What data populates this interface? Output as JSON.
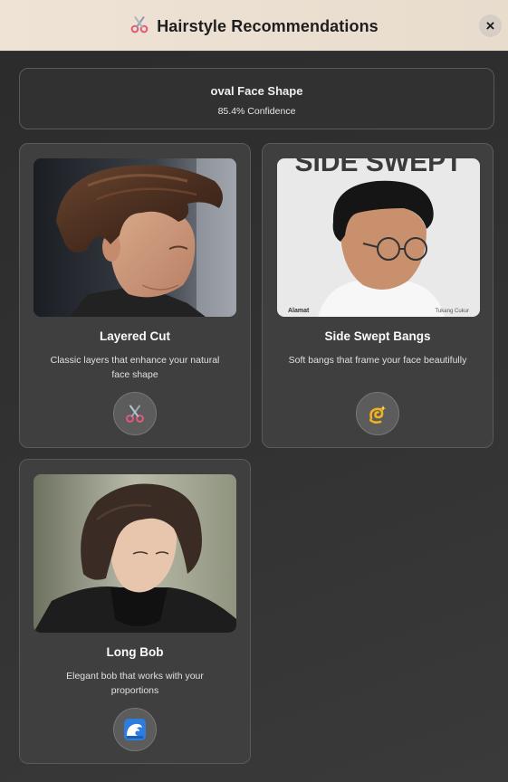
{
  "header": {
    "title": "Hairstyle Recommendations",
    "icon": "scissors-icon",
    "close_label": "×"
  },
  "summary": {
    "face_shape": "oval Face Shape",
    "confidence": "85.4% Confidence"
  },
  "cards": [
    {
      "title": "Layered Cut",
      "description": "Classic layers that enhance your natural face shape",
      "icon": "scissors-icon",
      "image_text": ""
    },
    {
      "title": "Side Swept Bangs",
      "description": "Soft bangs that frame your face beautifully",
      "icon": "dizzy-swirl-icon",
      "image_text": "SIDE SWEPT",
      "image_caption_left": "Alamat",
      "image_caption_right": "Tukang Cukur"
    },
    {
      "title": "Long Bob",
      "description": "Elegant bob that works with your proportions",
      "icon": "wave-icon",
      "image_text": ""
    }
  ],
  "colors": {
    "header_bg": "#efe3d6",
    "body_bg": "#2f2f2f",
    "card_bg": "#3f3f3f",
    "border": "#5a5a5a",
    "icon_circle": "#5c5c5c"
  }
}
